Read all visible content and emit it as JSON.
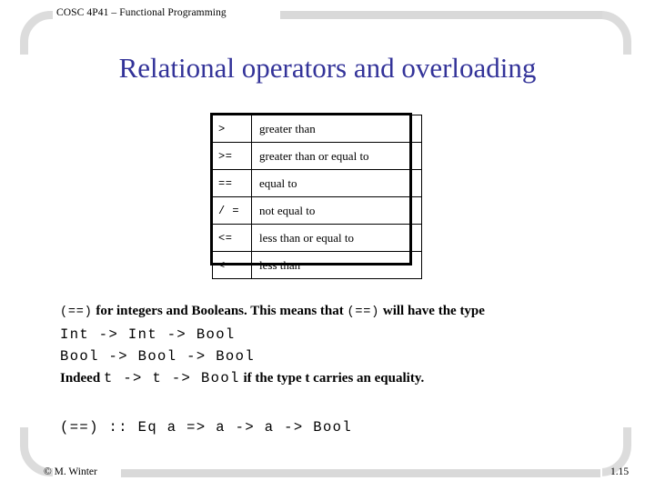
{
  "header": {
    "course_label": "COSC 4P41 – Functional Programming"
  },
  "title": "Relational operators and overloading",
  "operator_table": {
    "rows": [
      {
        "symbol": ">",
        "description": "greater than"
      },
      {
        "symbol": ">=",
        "description": "greater than or equal to"
      },
      {
        "symbol": "==",
        "description": "equal to"
      },
      {
        "symbol": "/ =",
        "description": "not equal to"
      },
      {
        "symbol": "<=",
        "description": "less than or equal to"
      },
      {
        "symbol": "<",
        "description": "less than"
      }
    ]
  },
  "body": {
    "line1_code1": "(==)",
    "line1_text1": "for integers and Booleans. This means that",
    "line1_code2": "(==)",
    "line1_text2": "will have the type",
    "line2_code": "Int -> Int -> Bool",
    "line3_code": "Bool -> Bool -> Bool",
    "line4_text1": "Indeed",
    "line4_code": "t -> t -> Bool",
    "line4_text2": "if the type t carries an equality.",
    "final_code": "(==) :: Eq a => a -> a -> Bool"
  },
  "footer": {
    "copyright": "© M. Winter",
    "slide_number": "1.15"
  },
  "colors": {
    "title": "#333399",
    "frame": "#dcdcdc",
    "bar": "#d9d9d9",
    "text": "#000000"
  }
}
